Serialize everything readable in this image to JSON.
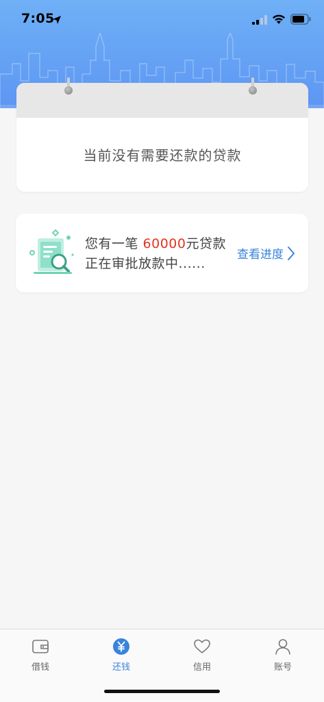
{
  "status_bar": {
    "time": "7:05"
  },
  "calendar_card": {
    "message": "当前没有需要还款的贷款"
  },
  "approval_card": {
    "text_prefix": "您有一笔 ",
    "amount": "60000",
    "text_suffix": "元贷款",
    "line2": "正在审批放款中......",
    "progress_link": "查看进度",
    "icon": "document-search-icon"
  },
  "tab_bar": {
    "tabs": [
      {
        "label": "借钱",
        "icon": "wallet-icon",
        "active": false
      },
      {
        "label": "还钱",
        "icon": "yuan-icon",
        "active": true
      },
      {
        "label": "信用",
        "icon": "heart-icon",
        "active": false
      },
      {
        "label": "账号",
        "icon": "user-icon",
        "active": false
      }
    ]
  },
  "colors": {
    "header_gradient_top": "#6fb0f6",
    "header_gradient_bottom": "#5d96f3",
    "accent": "#3a83dc",
    "amount": "#e2361f",
    "icon_green": "#6fd3b4"
  }
}
